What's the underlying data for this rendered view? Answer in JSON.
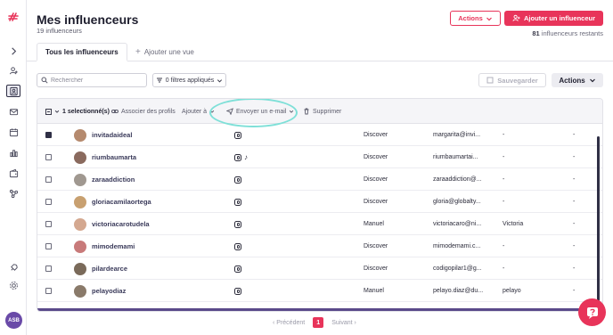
{
  "header": {
    "title": "Mes influenceurs",
    "count_label": "19 influenceurs",
    "actions_label": "Actions",
    "add_button_label": "Ajouter un influenceur",
    "remaining_count": "81",
    "remaining_label": "influenceurs restants"
  },
  "tabs": [
    {
      "label": "Tous les influenceurs",
      "active": true
    },
    {
      "label": "Ajouter une vue",
      "active": false
    }
  ],
  "toolbar": {
    "search_placeholder": "Rechercher",
    "filters_label": "0 filtres appliqués",
    "save_label": "Sauvegarder",
    "actions_label": "Actions"
  },
  "bulk": {
    "selected_label": "1 selectionné(s)",
    "associate_label": "Associer des profils",
    "add_to_label": "Ajouter à",
    "email_label": "Envoyer un e-mail",
    "delete_label": "Supprimer"
  },
  "rows": [
    {
      "username": "invitadaideal",
      "networks": [
        "instagram"
      ],
      "source": "Discover",
      "email": "margarita@invi...",
      "col5": "-",
      "col6": "-",
      "checked": true,
      "avatar_color": "#b58a6e"
    },
    {
      "username": "riumbaumarta",
      "networks": [
        "instagram",
        "tiktok"
      ],
      "source": "Discover",
      "email": "riumbaumartai...",
      "col5": "-",
      "col6": "-",
      "checked": false,
      "avatar_color": "#8a6a5e"
    },
    {
      "username": "zaraaddiction",
      "networks": [
        "instagram"
      ],
      "source": "Discover",
      "email": "zaraaddiction@...",
      "col5": "-",
      "col6": "-",
      "checked": false,
      "avatar_color": "#a09890"
    },
    {
      "username": "gloriacamilaortega",
      "networks": [
        "instagram"
      ],
      "source": "Discover",
      "email": "gloria@globalty...",
      "col5": "-",
      "col6": "-",
      "checked": false,
      "avatar_color": "#c8a070"
    },
    {
      "username": "victoriacarotudela",
      "networks": [
        "instagram"
      ],
      "source": "Manuel",
      "email": "victoriacaro@ni...",
      "col5": "Victoria",
      "col6": "-",
      "checked": false,
      "avatar_color": "#d4a890"
    },
    {
      "username": "mimodemami",
      "networks": [
        "instagram"
      ],
      "source": "Discover",
      "email": "mimodemami.c...",
      "col5": "-",
      "col6": "-",
      "checked": false,
      "avatar_color": "#c87a7a"
    },
    {
      "username": "pilardearce",
      "networks": [
        "instagram"
      ],
      "source": "Discover",
      "email": "codigopilar1@g...",
      "col5": "-",
      "col6": "-",
      "checked": false,
      "avatar_color": "#7a6a5a"
    },
    {
      "username": "pelayodiaz",
      "networks": [
        "instagram"
      ],
      "source": "Manuel",
      "email": "pelayo.diaz@du...",
      "col5": "pelayo",
      "col6": "-",
      "checked": false,
      "avatar_color": "#8a7a6a"
    }
  ],
  "pagination": {
    "prev_label": "Précédent",
    "current_page": "1",
    "next_label": "Suivant"
  },
  "sidebar": {
    "avatar_initials": "ASB"
  },
  "colors": {
    "brand": "#e8345a",
    "highlight_ring": "#7fe0d8"
  }
}
